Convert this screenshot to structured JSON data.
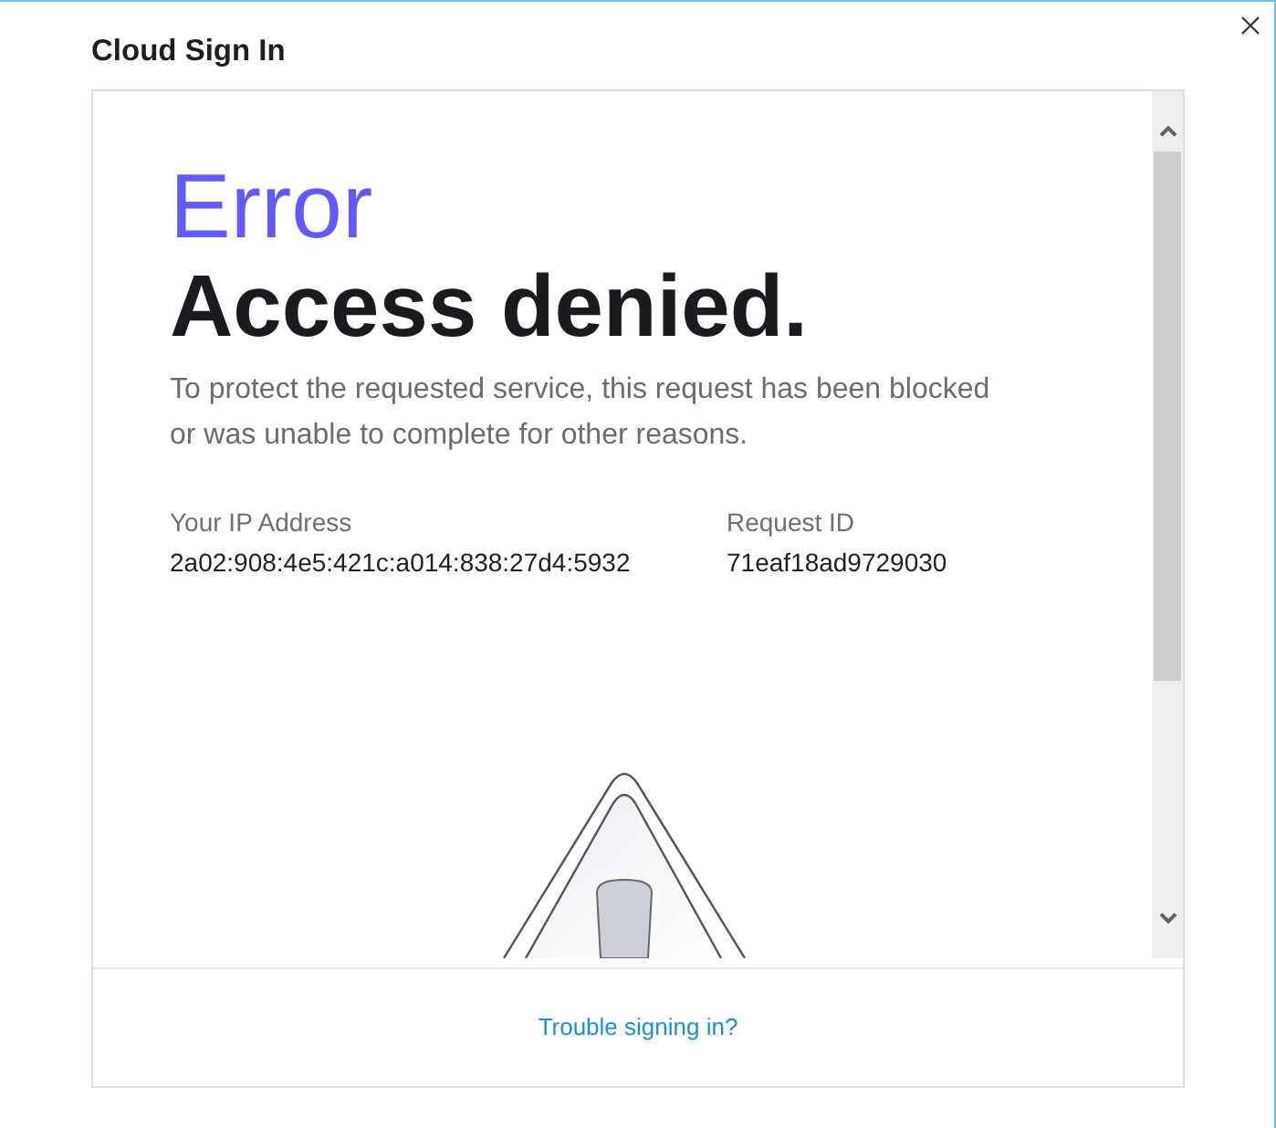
{
  "window": {
    "title": "Cloud Sign In"
  },
  "error_page": {
    "heading": "Error",
    "title": "Access denied.",
    "message": "To protect the requested service, this request has been blocked or was unable to complete for other reasons.",
    "details": [
      {
        "label": "Your IP Address",
        "value": "2a02:908:4e5:421c:a014:838:27d4:5932"
      },
      {
        "label": "Request ID",
        "value": "71eaf18ad9729030"
      }
    ]
  },
  "footer": {
    "link": "Trouble signing in?"
  }
}
